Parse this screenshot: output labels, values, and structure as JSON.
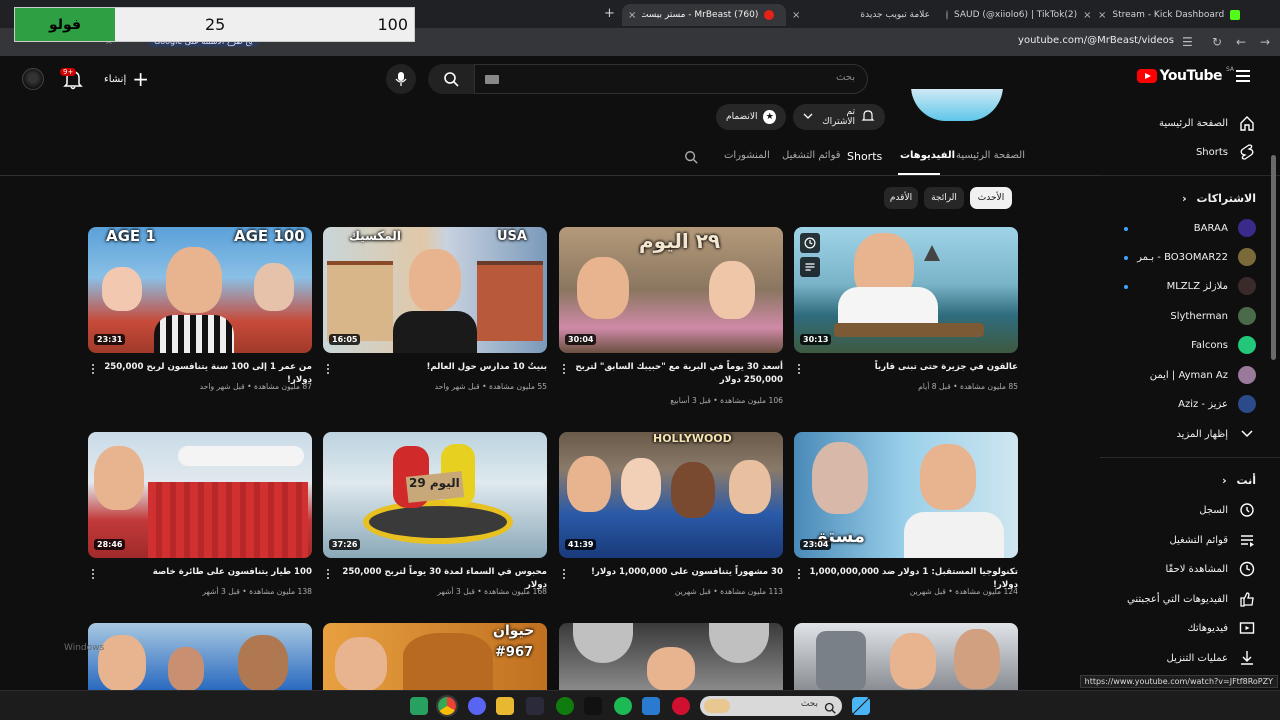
{
  "browser": {
    "tabs": [
      {
        "title": "(760) MrBeast - مستر بيست - Yo",
        "active": true
      },
      {
        "title": "علامة تبويب جديدة"
      },
      {
        "title": "SAUD (@xiiolo6) | TikTok(2)"
      },
      {
        "title": "Stream - Kick Dashboard"
      }
    ],
    "url": "youtube.com/@MrBeast/videos",
    "bookmark_chip": "Google يح طرح الاسئلة على"
  },
  "overlay": {
    "label": "فولو",
    "current": "25",
    "goal": "100",
    "fill": 0.25
  },
  "header": {
    "logo": "YouTube",
    "country": "SA",
    "search_placeholder": "بحث",
    "create_label": "إنشاء",
    "notif_count": "9+"
  },
  "sidebar": {
    "top": [
      {
        "label": "الصفحة الرئيسية",
        "icon": "home-icon"
      },
      {
        "label": "Shorts",
        "icon": "shorts-icon"
      }
    ],
    "subs_heading": "الاشتراكات",
    "subs": [
      {
        "label": "BARAA",
        "color": "#3a2a8a",
        "dot": true
      },
      {
        "label": "BO3OMAR22 - بـمر",
        "color": "#7a6a3a",
        "dot": true
      },
      {
        "label": "ملازلز MLZLZ",
        "color": "#3a2a2a",
        "dot": true
      },
      {
        "label": "Slytherman",
        "color": "#4a6a4a",
        "dot": false
      },
      {
        "label": "Falcons",
        "color": "#22c77a",
        "dot": false
      },
      {
        "label": "Ayman Az | ايمن",
        "color": "#9a7a9a",
        "dot": false
      },
      {
        "label": "عزيز - Aziz",
        "color": "#2a4a8a",
        "dot": false
      }
    ],
    "show_more": "إظهار المزيد",
    "you_heading": "أنت",
    "you": [
      {
        "label": "السجل",
        "icon": "history-icon"
      },
      {
        "label": "قوائم التشغيل",
        "icon": "playlist-icon"
      },
      {
        "label": "المشاهدة لاحقًا",
        "icon": "clock-icon"
      },
      {
        "label": "الفيديوهات التي أعجبتني",
        "icon": "like-icon"
      },
      {
        "label": "فيديوهاتك",
        "icon": "your-videos-icon"
      },
      {
        "label": "عمليات التنزيل",
        "icon": "download-icon"
      }
    ]
  },
  "channel": {
    "join_label": "الانضمام",
    "subscribed_label": "تم الاشتراك",
    "tabs": [
      "الصفحة الرئيسية",
      "الفيديوهات",
      "Shorts",
      "قوائم التشغيل",
      "المنشورات"
    ],
    "active_tab": "الفيديوهات",
    "chips": [
      "الأحدث",
      "الرائجة",
      "الأقدم"
    ]
  },
  "videos": [
    {
      "duration": "30:13",
      "title": "عالقون في جزيرة حتى تبنى قارباً",
      "meta": "85 مليون مشاهدة • قبل 8 أيام"
    },
    {
      "duration": "30:04",
      "title": "أسعد 30 يوماً في البرية مع \"حبيبك السابق\" لتربح 250,000 دولار",
      "meta": "106 مليون مشاهدة • قبل 3 أسابيع"
    },
    {
      "duration": "16:05",
      "title": "بنيتُ 10 مدارس حول العالم!",
      "meta": "55 مليون مشاهدة • قبل شهر واحد",
      "tag_left": "المكسيك",
      "tag_right": "USA"
    },
    {
      "duration": "23:31",
      "title": "من عمر 1 إلى 100 سنة يتنافسون لربح 250,000 دولار!",
      "meta": "87 مليون مشاهدة • قبل شهر واحد",
      "tag_left": "AGE 1",
      "tag_right": "AGE 100"
    },
    {
      "duration": "23:04",
      "title": "تكنولوجيا المستقبل: 1 دولار ضد 1,000,000,000 دولار!",
      "meta": "124 مليون مشاهدة • قبل شهرين",
      "tag_left": "مستق"
    },
    {
      "duration": "41:39",
      "title": "30 مشهوراً يتنافسون على 1,000,000 دولار!",
      "meta": "113 مليون مشاهدة • قبل شهرين",
      "tag_left": "HOLLYWOOD"
    },
    {
      "duration": "37:26",
      "title": "محبوس في السماء لمدة 30 يوماً لتربح 250,000 دولار",
      "meta": "168 مليون مشاهدة • قبل 3 أشهر",
      "tag_left": "اليوم 29"
    },
    {
      "duration": "28:46",
      "title": "100 طيار يتنافسون على طائرة خاصة",
      "meta": "138 مليون مشاهدة • قبل 3 أشهر"
    },
    {
      "tag_left": ""
    },
    {
      "tag_left": ""
    },
    {
      "tag_left": "حيوان",
      "tag_right": "#967"
    },
    {
      "tag_left": ""
    }
  ],
  "status_url": "https://www.youtube.com/watch?v=JFtf8RoPZY",
  "windows_watermark": "Windows",
  "taskbar_search": "بحث"
}
